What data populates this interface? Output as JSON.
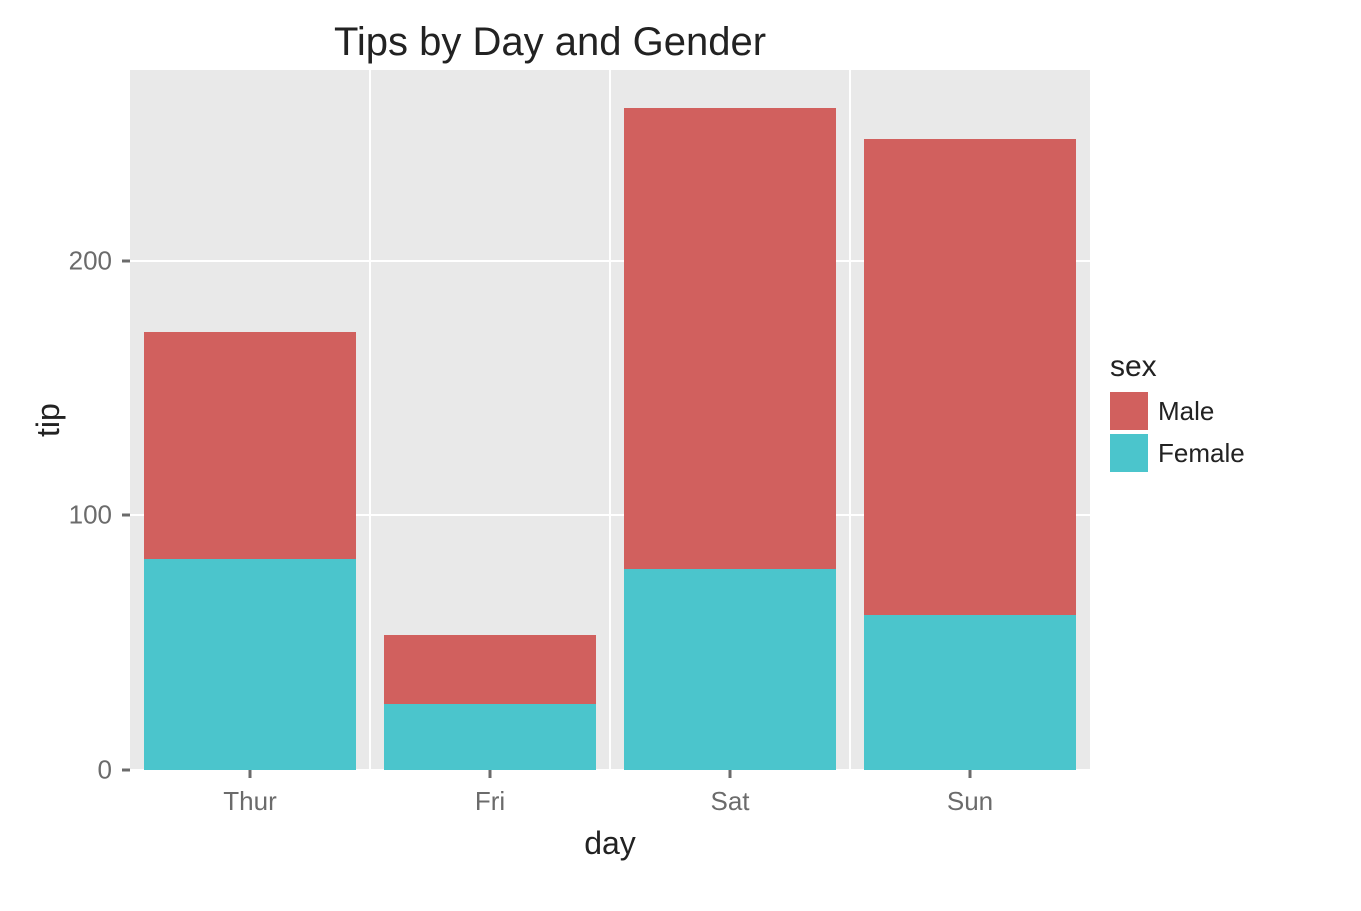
{
  "chart_data": {
    "type": "bar",
    "title": "Tips by Day and Gender",
    "xlabel": "day",
    "ylabel": "tip",
    "legend_title": "sex",
    "categories": [
      "Thur",
      "Fri",
      "Sat",
      "Sun"
    ],
    "series": [
      {
        "name": "Male",
        "values": [
          89,
          27,
          181,
          187
        ],
        "color": "#d1605e"
      },
      {
        "name": "Female",
        "values": [
          83,
          26,
          79,
          61
        ],
        "color": "#4bc5cc"
      }
    ],
    "y_ticks": [
      0,
      100,
      200
    ],
    "ylim": [
      0,
      275
    ],
    "stacked": true,
    "grid": true
  }
}
